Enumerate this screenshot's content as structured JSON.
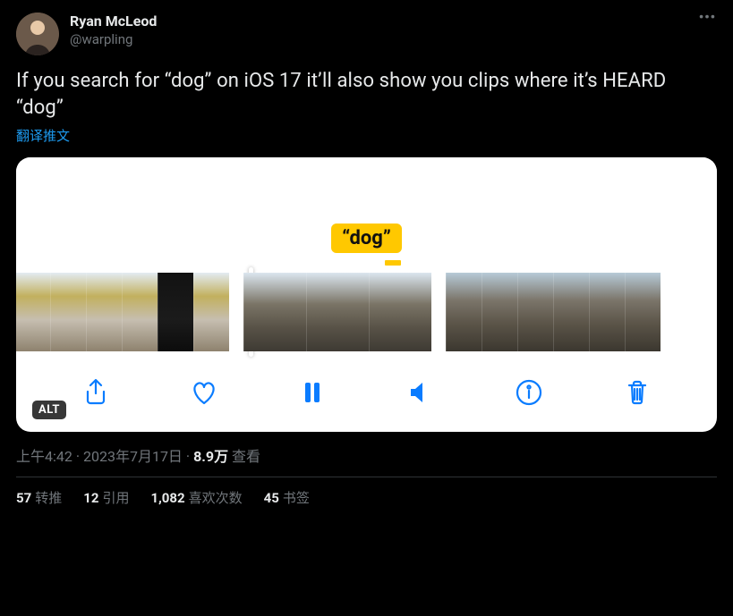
{
  "user": {
    "display_name": "Ryan McLeod",
    "handle": "@warpling"
  },
  "tweet": {
    "text": "If you search for “dog” on iOS 17 it’ll also show you clips where it’s HEARD “dog”",
    "translate_label": "翻译推文"
  },
  "media": {
    "caption_chip": "“dog”",
    "alt_badge": "ALT"
  },
  "meta": {
    "time": "上午4:42",
    "date": "2023年7月17日",
    "sep": " · ",
    "views_num": "8.9万",
    "views_label": " 查看"
  },
  "stats": {
    "retweets_num": "57",
    "retweets_label": "转推",
    "quotes_num": "12",
    "quotes_label": "引用",
    "likes_num": "1,082",
    "likes_label": "喜欢次数",
    "bookmarks_num": "45",
    "bookmarks_label": "书签"
  }
}
